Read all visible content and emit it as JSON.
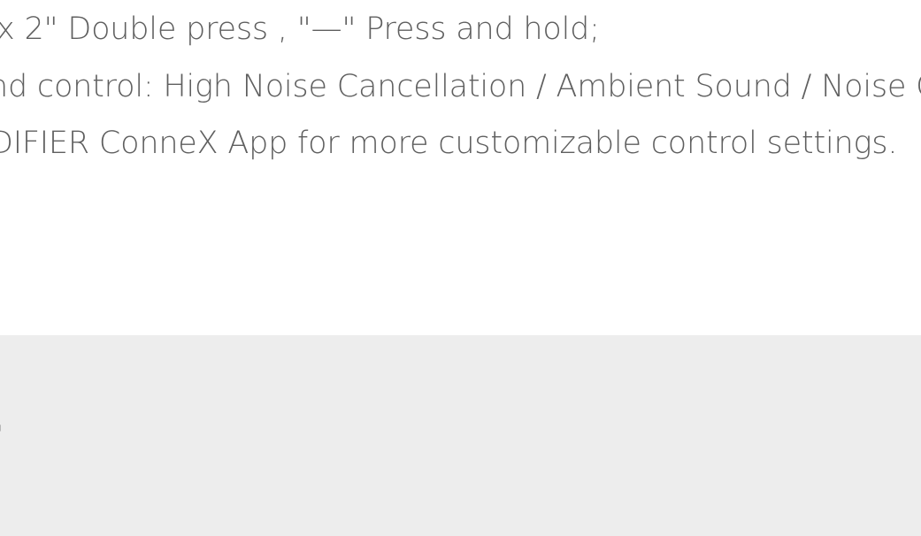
{
  "feature_description": {
    "lines": [
      "x 2\" Double press , \"—\" Press and hold;",
      "nd control: High Noise Cancellation / Ambient Sound / Noise Ca",
      "DIFIER ConneX App for more customizable control settings."
    ]
  },
  "next_section": {
    "heading_fragment": "t"
  },
  "colors": {
    "text": "#5f5f5f",
    "section_background": "#ededed",
    "page_background": "#ffffff",
    "heading": "#6b6b6b"
  }
}
